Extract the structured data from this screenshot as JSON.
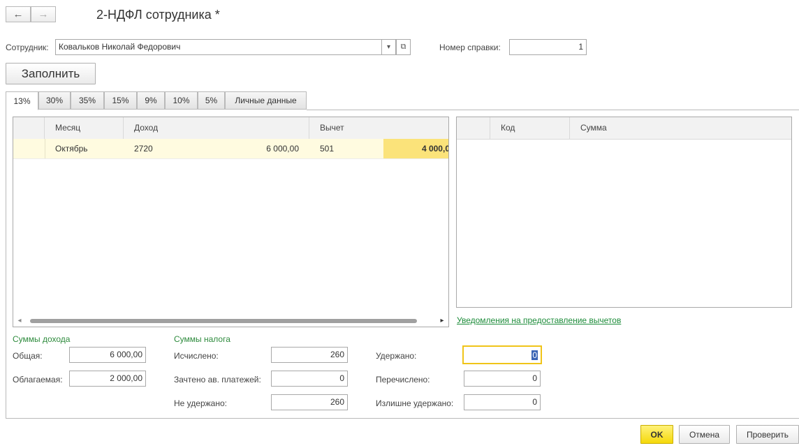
{
  "nav": {
    "back_icon": "←",
    "forward_icon": "→"
  },
  "window": {
    "title": "2-НДФЛ сотрудника *"
  },
  "employee": {
    "label": "Сотрудник:",
    "value": "Ковальков Николай Федорович",
    "dropdown_icon": "▾",
    "open_icon": "⧉"
  },
  "certificate": {
    "label": "Номер справки:",
    "value": "1"
  },
  "fill_button": "Заполнить",
  "tabs": [
    "13%",
    "30%",
    "35%",
    "15%",
    "9%",
    "10%",
    "5%",
    "Личные данные"
  ],
  "income_table": {
    "columns": {
      "month": "Месяц",
      "income": "Доход",
      "deduction": "Вычет"
    },
    "rows": [
      {
        "month": "Октябрь",
        "income_code": "2720",
        "income_amount": "6 000,00",
        "deduction_code": "501",
        "deduction_amount": "4 000,0"
      }
    ],
    "scroll_left": "◂",
    "scroll_right": "▸"
  },
  "deductions_table": {
    "columns": {
      "code": "Код",
      "sum": "Сумма"
    }
  },
  "notifications_link": "Уведомления на предоставление вычетов",
  "income_sums": {
    "heading": "Суммы дохода",
    "total_label": "Общая:",
    "total_value": "6 000,00",
    "taxable_label": "Облагаемая:",
    "taxable_value": "2 000,00"
  },
  "tax_sums": {
    "heading": "Суммы налога",
    "calculated_label": "Исчислено:",
    "calculated_value": "260",
    "advance_label": "Зачтено ав. платежей:",
    "advance_value": "0",
    "not_withheld_label": "Не удержано:",
    "not_withheld_value": "260",
    "withheld_label": "Удержано:",
    "withheld_value": "0",
    "transferred_label": "Перечислено:",
    "transferred_value": "0",
    "overwithheld_label": "Излишне удержано:",
    "overwithheld_value": "0"
  },
  "footer": {
    "ok": "OK",
    "cancel": "Отмена",
    "check": "Проверить"
  },
  "colors": {
    "selected_row": "#fffbe0",
    "selected_cell": "#fbe37a",
    "accent_green": "#2e8b3d",
    "primary_button": "#f5d90a"
  }
}
